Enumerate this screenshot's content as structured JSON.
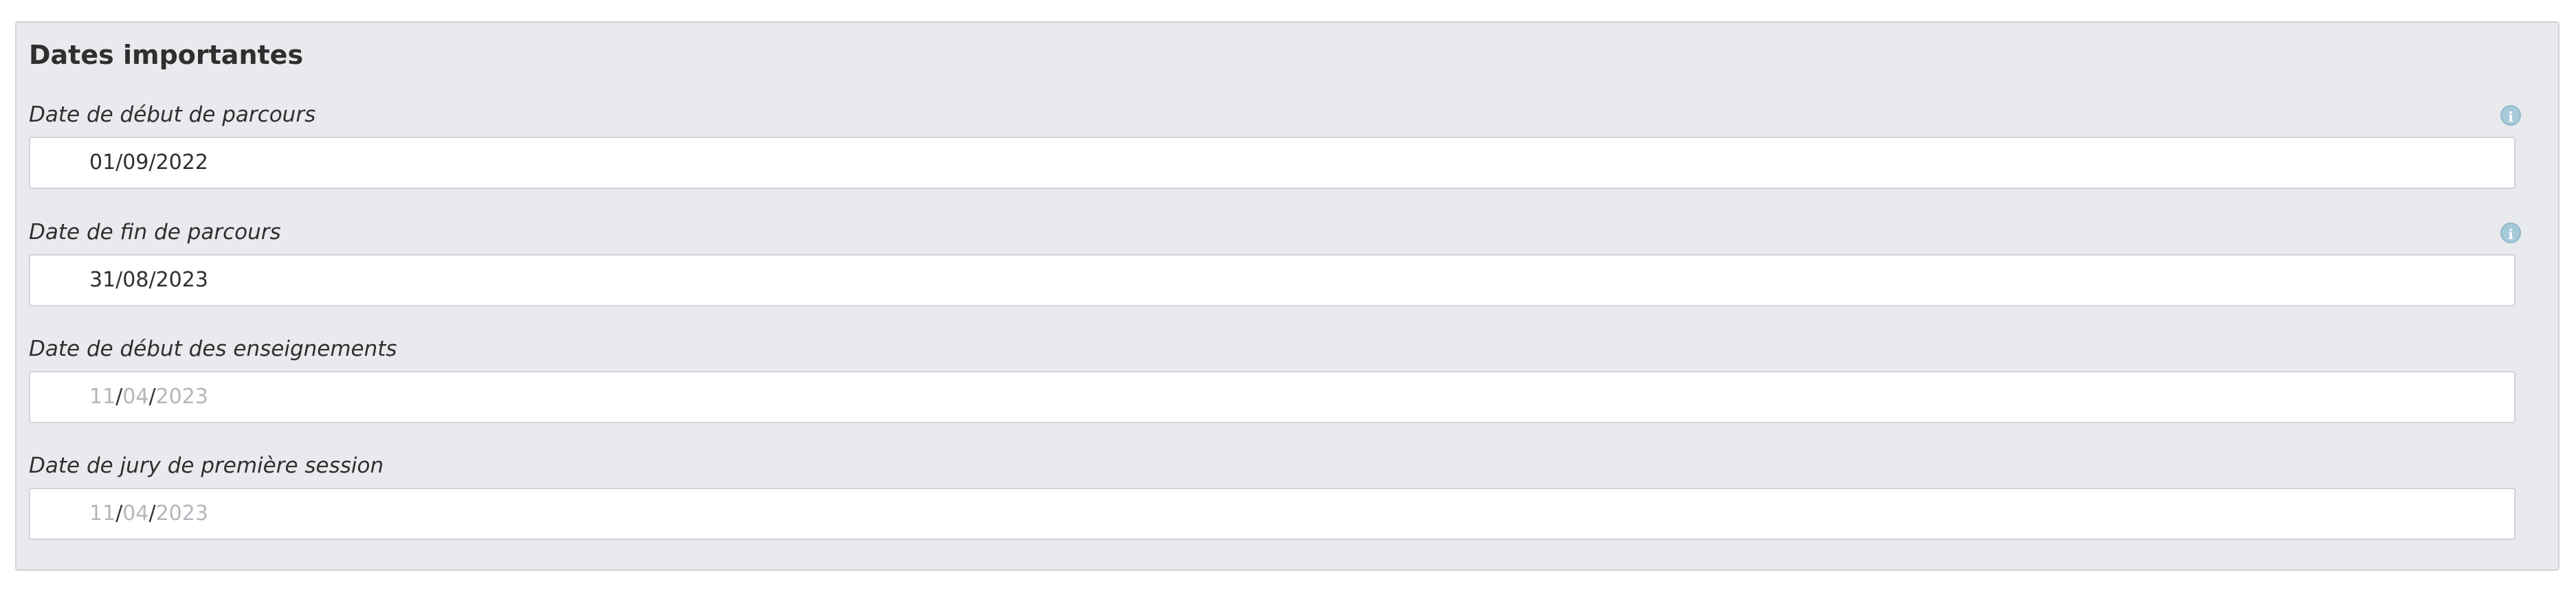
{
  "section": {
    "title": "Dates importantes"
  },
  "fields": [
    {
      "label": "Date de début de parcours",
      "value": "01/09/2022",
      "has_info_icon": true
    },
    {
      "label": "Date de fin de parcours",
      "value": "31/08/2023",
      "has_info_icon": true
    },
    {
      "label": "Date de début des enseignements",
      "placeholder": {
        "day": "11",
        "month": "04",
        "year": "2023",
        "separator": "/"
      },
      "has_info_icon": false
    },
    {
      "label": "Date de jury de première session",
      "placeholder": {
        "day": "11",
        "month": "04",
        "year": "2023",
        "separator": "/"
      },
      "has_info_icon": false
    }
  ],
  "icons": {
    "info": "info-icon"
  },
  "colors": {
    "panel_background": "#e9eaed",
    "info_icon": "#a7cad9",
    "placeholder_text": "#b3b6bb"
  }
}
